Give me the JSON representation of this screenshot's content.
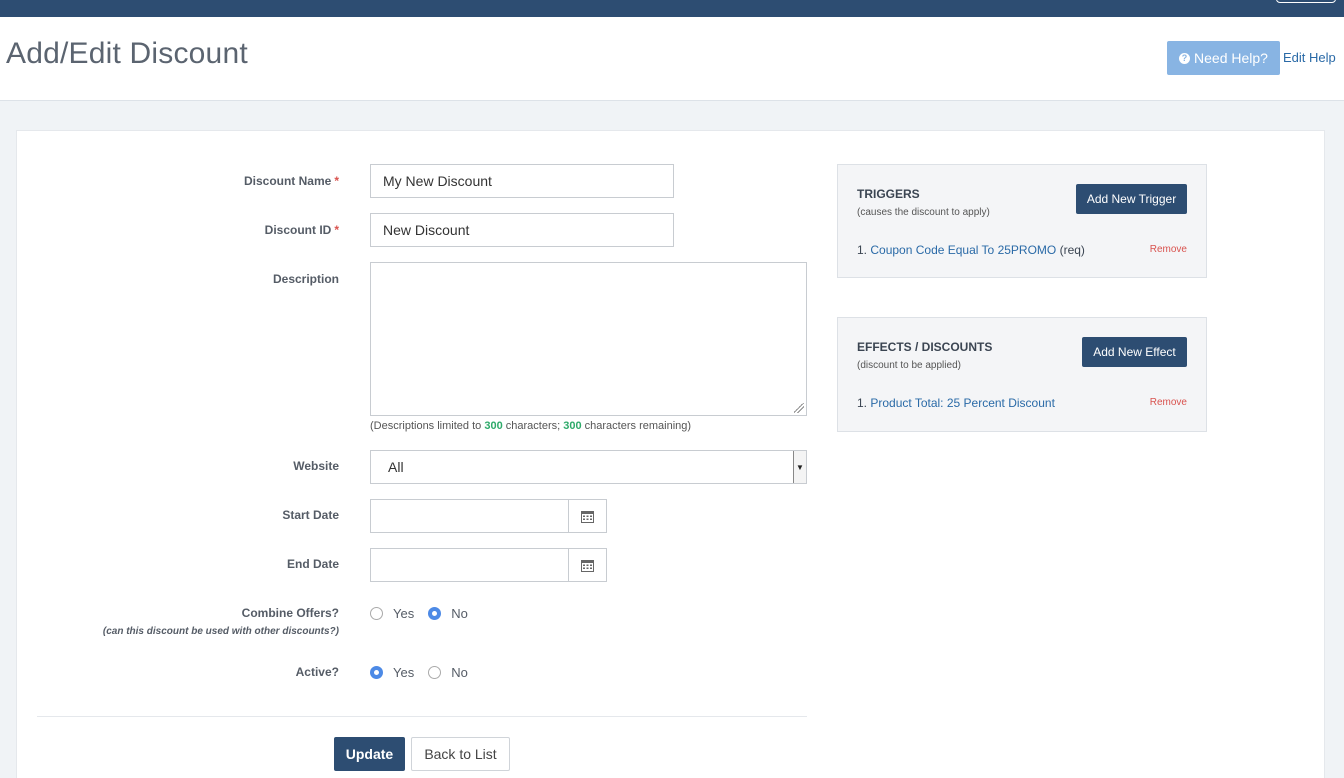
{
  "header": {
    "title": "Add/Edit Discount",
    "help_button": "Need Help?",
    "help_icon": "question-circle-icon",
    "edit_help_link": "Edit Help"
  },
  "form": {
    "discount_name": {
      "label": "Discount Name",
      "required_mark": "*",
      "value": "My New Discount"
    },
    "discount_id": {
      "label": "Discount ID",
      "required_mark": "*",
      "value": "New Discount"
    },
    "description": {
      "label": "Description",
      "value": "",
      "helper_prefix": "(Descriptions limited to",
      "limit": "300",
      "helper_middle": "characters;",
      "remaining": "300",
      "helper_suffix": "characters remaining)"
    },
    "website": {
      "label": "Website",
      "selected": "All"
    },
    "start_date": {
      "label": "Start Date",
      "value": "",
      "icon": "calendar-icon"
    },
    "end_date": {
      "label": "End Date",
      "value": "",
      "icon": "calendar-icon"
    },
    "combine_offers": {
      "label": "Combine Offers?",
      "sublabel": "(can this discount be used with other discounts?)",
      "options": [
        "Yes",
        "No"
      ],
      "selected": "No"
    },
    "active": {
      "label": "Active?",
      "options": [
        "Yes",
        "No"
      ],
      "selected": "Yes"
    },
    "update_button": "Update",
    "back_button": "Back to List"
  },
  "triggers": {
    "title": "TRIGGERS",
    "subtitle": "(causes the discount to apply)",
    "add_button": "Add New Trigger",
    "items": [
      {
        "index": "1.",
        "link": "Coupon Code Equal To 25PROMO",
        "suffix": "(req)",
        "remove": "Remove"
      }
    ]
  },
  "effects": {
    "title": "EFFECTS / DISCOUNTS",
    "subtitle": "(discount to be applied)",
    "add_button": "Add New Effect",
    "items": [
      {
        "index": "1.",
        "link": "Product Total: 25 Percent Discount",
        "remove": "Remove"
      }
    ]
  },
  "colors": {
    "navbar": "#2d4d72",
    "primary_button": "#2d4d72",
    "help_button": "#88b4e3",
    "link": "#2a6aa7",
    "remove": "#d9534f",
    "counter": "#2eaa6a",
    "radio_checked": "#4d8ae6"
  }
}
